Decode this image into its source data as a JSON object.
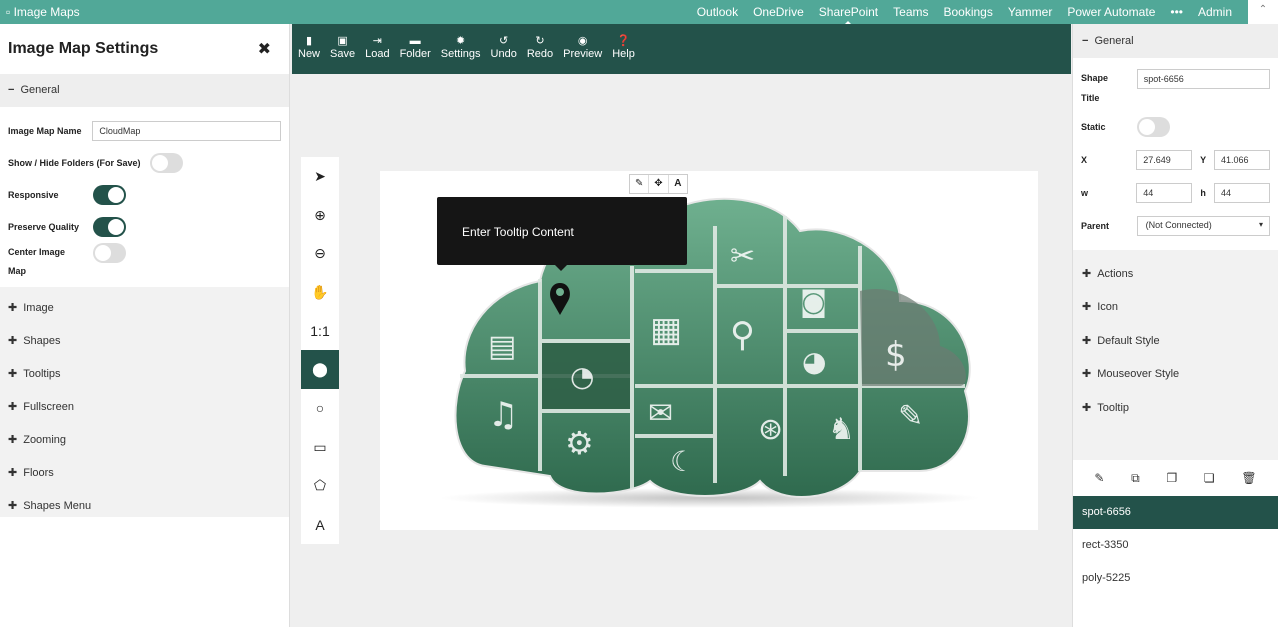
{
  "suitebar": {
    "app_title": "Image Maps",
    "links": [
      "Outlook",
      "OneDrive",
      "SharePoint",
      "Teams",
      "Bookings",
      "Yammer",
      "Power Automate",
      "•••",
      "Admin"
    ],
    "active_link": "SharePoint"
  },
  "left_panel": {
    "title": "Image Map Settings",
    "general_label": "General",
    "fields": {
      "image_map_name_label": "Image Map Name",
      "image_map_name_value": "CloudMap",
      "show_hide_label": "Show / Hide Folders (For Save)",
      "show_hide_on": false,
      "responsive_label": "Responsive",
      "responsive_on": true,
      "preserve_quality_label": "Preserve Quality",
      "preserve_quality_on": true,
      "center_label_line1": "Center Image",
      "center_label_line2": "Map",
      "center_on": false
    },
    "sections": [
      "Image",
      "Shapes",
      "Tooltips",
      "Fullscreen",
      "Zooming",
      "Floors",
      "Shapes Menu"
    ]
  },
  "toolbar": {
    "buttons": [
      {
        "label": "New",
        "icon": "file-icon"
      },
      {
        "label": "Save",
        "icon": "save-icon"
      },
      {
        "label": "Load",
        "icon": "load-icon"
      },
      {
        "label": "Folder",
        "icon": "folder-icon"
      },
      {
        "label": "Settings",
        "icon": "gear-icon"
      },
      {
        "label": "Undo",
        "icon": "undo-icon"
      },
      {
        "label": "Redo",
        "icon": "redo-icon"
      },
      {
        "label": "Preview",
        "icon": "eye-icon"
      },
      {
        "label": "Help",
        "icon": "help-icon"
      }
    ]
  },
  "drawing_tools": {
    "items": [
      "select-arrow-icon",
      "zoom-in-icon",
      "zoom-out-icon",
      "hand-icon",
      "1:1",
      "map-pin-icon",
      "circle-icon",
      "rectangle-icon",
      "polygon-icon",
      "text-icon"
    ],
    "active": "map-pin-icon",
    "reset_zoom_label": "1:1"
  },
  "canvas": {
    "tooltip_text": "Enter Tooltip Content",
    "shape_tools": [
      "brush-icon",
      "move-icon",
      "text-icon"
    ],
    "text_tool_glyph": "A",
    "accent": "#23524a",
    "cloud_color": "#3a7a5e"
  },
  "right_panel": {
    "general_label": "General",
    "shape_title_label_line1": "Shape",
    "shape_title_label_line2": "Title",
    "shape_title_value": "spot-6656",
    "static_label": "Static",
    "static_on": false,
    "x_label": "X",
    "x_value": "27.649",
    "y_label": "Y",
    "y_value": "41.066",
    "w_label": "w",
    "w_value": "44",
    "h_label": "h",
    "h_value": "44",
    "parent_label": "Parent",
    "parent_value": "(Not Connected)",
    "sections": [
      "Actions",
      "Icon",
      "Default Style",
      "Mouseover Style",
      "Tooltip"
    ],
    "shape_actions": [
      "pencil-icon",
      "duplicate-icon",
      "paste-icon",
      "copy-icon",
      "trash-icon"
    ],
    "shapes": [
      "spot-6656",
      "rect-3350",
      "poly-5225"
    ],
    "selected_shape": "spot-6656"
  },
  "colors": {
    "suitebar": "#51a898",
    "toolbar": "#23524a"
  }
}
